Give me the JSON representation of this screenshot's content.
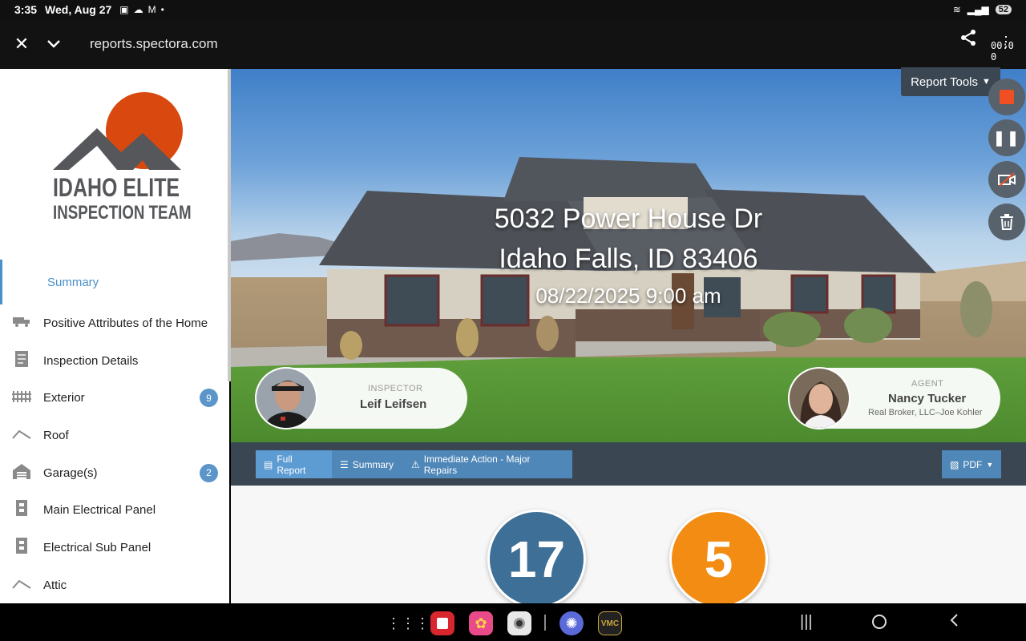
{
  "status_bar": {
    "time": "3:35",
    "date": "Wed, Aug 27",
    "battery": "52"
  },
  "browser": {
    "url": "reports.spectora.com",
    "recorder_timer": "00:0\n0"
  },
  "logo": {
    "line1": "IDAHO ELITE",
    "line2": "INSPECTION TEAM"
  },
  "sidebar": {
    "summary_label": "Summary",
    "items": [
      {
        "label": "Positive Attributes of the Home",
        "icon": "truck-icon"
      },
      {
        "label": "Inspection Details",
        "icon": "document-icon"
      },
      {
        "label": "Exterior",
        "icon": "fence-icon",
        "badge": "9"
      },
      {
        "label": "Roof",
        "icon": "roof-icon"
      },
      {
        "label": "Garage(s)",
        "icon": "garage-icon",
        "badge": "2"
      },
      {
        "label": "Main Electrical Panel",
        "icon": "panel-icon"
      },
      {
        "label": "Electrical Sub Panel",
        "icon": "panel-icon"
      },
      {
        "label": "Attic",
        "icon": "attic-icon"
      }
    ]
  },
  "hero": {
    "address_line1": "5032 Power House Dr",
    "address_line2": "Idaho Falls, ID 83406",
    "datetime": "08/22/2025 9:00 am",
    "inspector": {
      "role": "INSPECTOR",
      "name": "Leif Leifsen"
    },
    "agent": {
      "role": "AGENT",
      "name": "Nancy Tucker",
      "company": "Real Broker, LLC–Joe Kohler"
    }
  },
  "report_tools_label": "Report Tools",
  "toolbar": {
    "full_report": "Full Report",
    "summary": "Summary",
    "immediate": "Immediate Action - Major Repairs",
    "pdf": "PDF"
  },
  "counts": {
    "blue": "17",
    "orange": "5"
  },
  "colors": {
    "accent_blue": "#4a90c8",
    "logo_orange": "#d9480f",
    "count_blue": "#3e6f96",
    "count_orange": "#f28c13",
    "toolbar_bg": "#3a4652"
  }
}
